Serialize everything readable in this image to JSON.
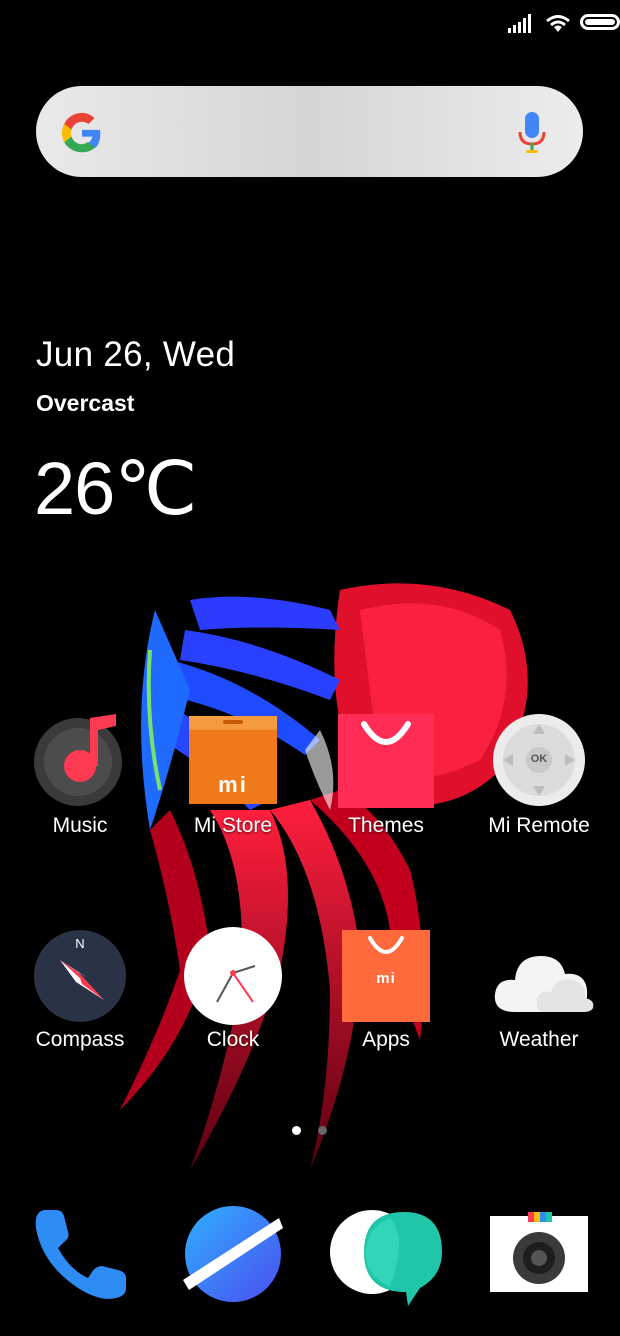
{
  "status_bar": {
    "signal_icon": "signal-icon",
    "wifi_icon": "wifi-icon",
    "battery_icon": "battery-icon",
    "battery_level": 1.0
  },
  "search": {
    "logo_icon": "google-g-icon",
    "mic_icon": "mic-icon"
  },
  "weather_widget": {
    "date": "Jun 26, Wed",
    "condition": "Overcast",
    "temperature": "26℃"
  },
  "apps_row1": [
    {
      "label": "Music",
      "icon": "music-icon"
    },
    {
      "label": "Mi Store",
      "icon": "mi-store-icon"
    },
    {
      "label": "Themes",
      "icon": "themes-icon"
    },
    {
      "label": "Mi Remote",
      "icon": "mi-remote-icon"
    }
  ],
  "apps_row2": [
    {
      "label": "Compass",
      "icon": "compass-icon"
    },
    {
      "label": "Clock",
      "icon": "clock-icon"
    },
    {
      "label": "Apps",
      "icon": "apps-store-icon"
    },
    {
      "label": "Weather",
      "icon": "weather-icon"
    }
  ],
  "compass_letter": "N",
  "mi_logo": "mi",
  "remote_ok": "OK",
  "page_indicator": {
    "count": 2,
    "active": 1
  },
  "dock": [
    {
      "icon": "phone-icon"
    },
    {
      "icon": "browser-icon"
    },
    {
      "icon": "messaging-icon"
    },
    {
      "icon": "camera-icon"
    }
  ],
  "colors": {
    "accent_red": "#ff2d55",
    "orange": "#f26b21",
    "dark_bg": "#000000"
  }
}
